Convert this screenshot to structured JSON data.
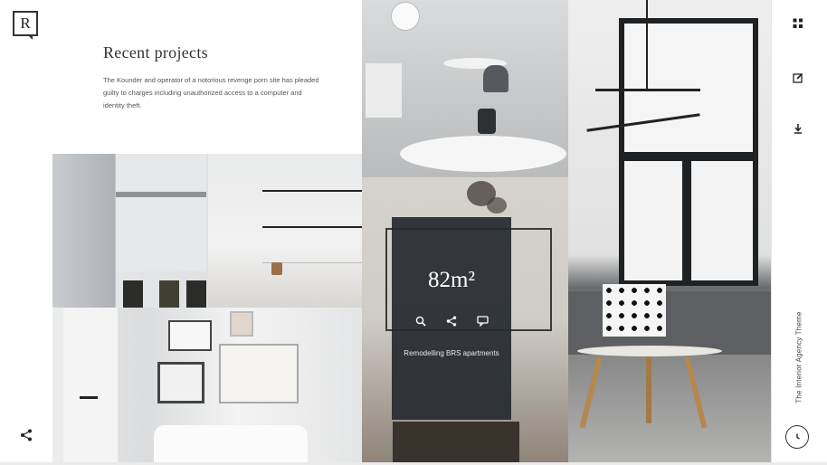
{
  "brand": {
    "logo_letter": "R"
  },
  "section": {
    "title": "Recent projects",
    "description": "The Kounder and operator of a notorious revenge porn site has pleaded guilty to charges including unauthorized access to a computer and identity theft."
  },
  "project_overlay": {
    "area": "82m²",
    "caption": "Remodelling BRS apartments",
    "icons": [
      "search-icon",
      "share-icon",
      "comment-icon"
    ]
  },
  "sidebar": {
    "icons": [
      "grid-icon",
      "edit-icon",
      "download-icon"
    ],
    "vertical_text": "The Interior Agency Theme",
    "bottom_icon": "clock-icon"
  },
  "colors": {
    "overlay_bg": "#25292f",
    "text_dark": "#333333",
    "sidebar_bg": "#ffffff"
  }
}
